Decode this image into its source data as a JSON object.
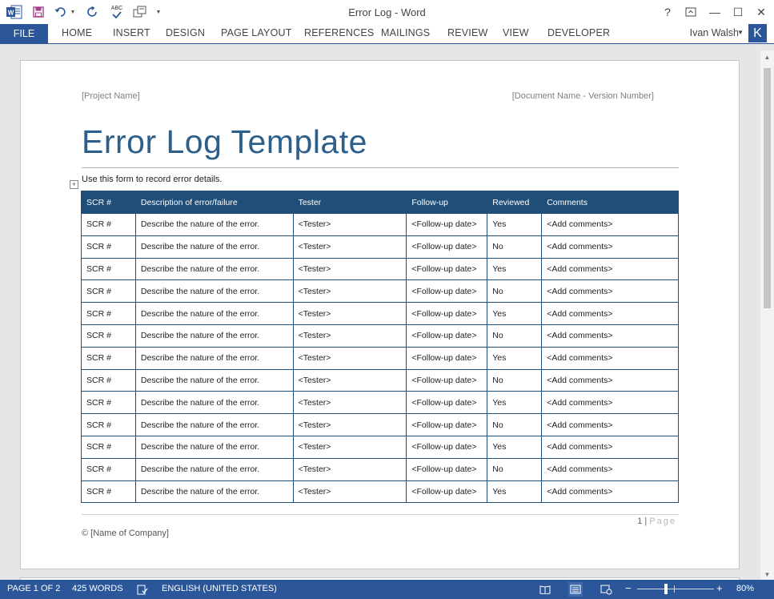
{
  "window": {
    "title": "Error Log - Word",
    "help": "?",
    "minimize": "—",
    "restore": "☐",
    "close": "✕"
  },
  "quick_access": {
    "save_icon": "save-icon",
    "undo_icon": "undo-icon",
    "redo_icon": "redo-icon",
    "spelling_label": "ABC",
    "customize_icon": "chevron-down-icon"
  },
  "ribbon": {
    "file": "FILE",
    "tabs": [
      "HOME",
      "INSERT",
      "DESIGN",
      "PAGE LAYOUT",
      "REFERENCES",
      "MAILINGS",
      "REVIEW",
      "VIEW",
      "DEVELOPER"
    ],
    "user": "Ivan Walsh",
    "avatar_letter": "K"
  },
  "document": {
    "header_left": "[Project Name]",
    "header_right": "[Document Name - Version Number]",
    "title": "Error Log Template",
    "intro": "Use this form to record error details.",
    "table": {
      "headers": [
        "SCR #",
        "Description of error/failure",
        "Tester",
        "Follow-up",
        "Reviewed",
        "Comments"
      ],
      "rows": [
        [
          "SCR #",
          "Describe the nature of the error.",
          "<Tester>",
          "<Follow-up date>",
          "Yes",
          "<Add comments>"
        ],
        [
          "SCR #",
          "Describe the nature of the error.",
          "<Tester>",
          "<Follow-up date>",
          "No",
          "<Add comments>"
        ],
        [
          "SCR #",
          "Describe the nature of the error.",
          "<Tester>",
          "<Follow-up date>",
          "Yes",
          "<Add comments>"
        ],
        [
          "SCR #",
          "Describe the nature of the error.",
          "<Tester>",
          "<Follow-up date>",
          "No",
          "<Add comments>"
        ],
        [
          "SCR #",
          "Describe the nature of the error.",
          "<Tester>",
          "<Follow-up date>",
          "Yes",
          "<Add comments>"
        ],
        [
          "SCR #",
          "Describe the nature of the error.",
          "<Tester>",
          "<Follow-up date>",
          "No",
          "<Add comments>"
        ],
        [
          "SCR #",
          "Describe the nature of the error.",
          "<Tester>",
          "<Follow-up date>",
          "Yes",
          "<Add comments>"
        ],
        [
          "SCR #",
          "Describe the nature of the error.",
          "<Tester>",
          "<Follow-up date>",
          "No",
          "<Add comments>"
        ],
        [
          "SCR #",
          "Describe the nature of the error.",
          "<Tester>",
          "<Follow-up date>",
          "Yes",
          "<Add comments>"
        ],
        [
          "SCR #",
          "Describe the nature of the error.",
          "<Tester>",
          "<Follow-up date>",
          "No",
          "<Add comments>"
        ],
        [
          "SCR #",
          "Describe the nature of the error.",
          "<Tester>",
          "<Follow-up date>",
          "Yes",
          "<Add comments>"
        ],
        [
          "SCR #",
          "Describe the nature of the error.",
          "<Tester>",
          "<Follow-up date>",
          "No",
          "<Add comments>"
        ],
        [
          "SCR #",
          "Describe the nature of the error.",
          "<Tester>",
          "<Follow-up date>",
          "Yes",
          "<Add comments>"
        ]
      ]
    },
    "footer_page_number": "1",
    "footer_page_word": "Page",
    "footer_company": "© [Name of Company]"
  },
  "status": {
    "page": "PAGE 1 OF 2",
    "words": "425 WORDS",
    "language": "ENGLISH (UNITED STATES)",
    "zoom_minus": "−",
    "zoom_plus": "+",
    "zoom": "80%"
  },
  "colors": {
    "accent": "#2b579a",
    "table_header": "#1f4e79",
    "title": "#2d5f8b"
  }
}
